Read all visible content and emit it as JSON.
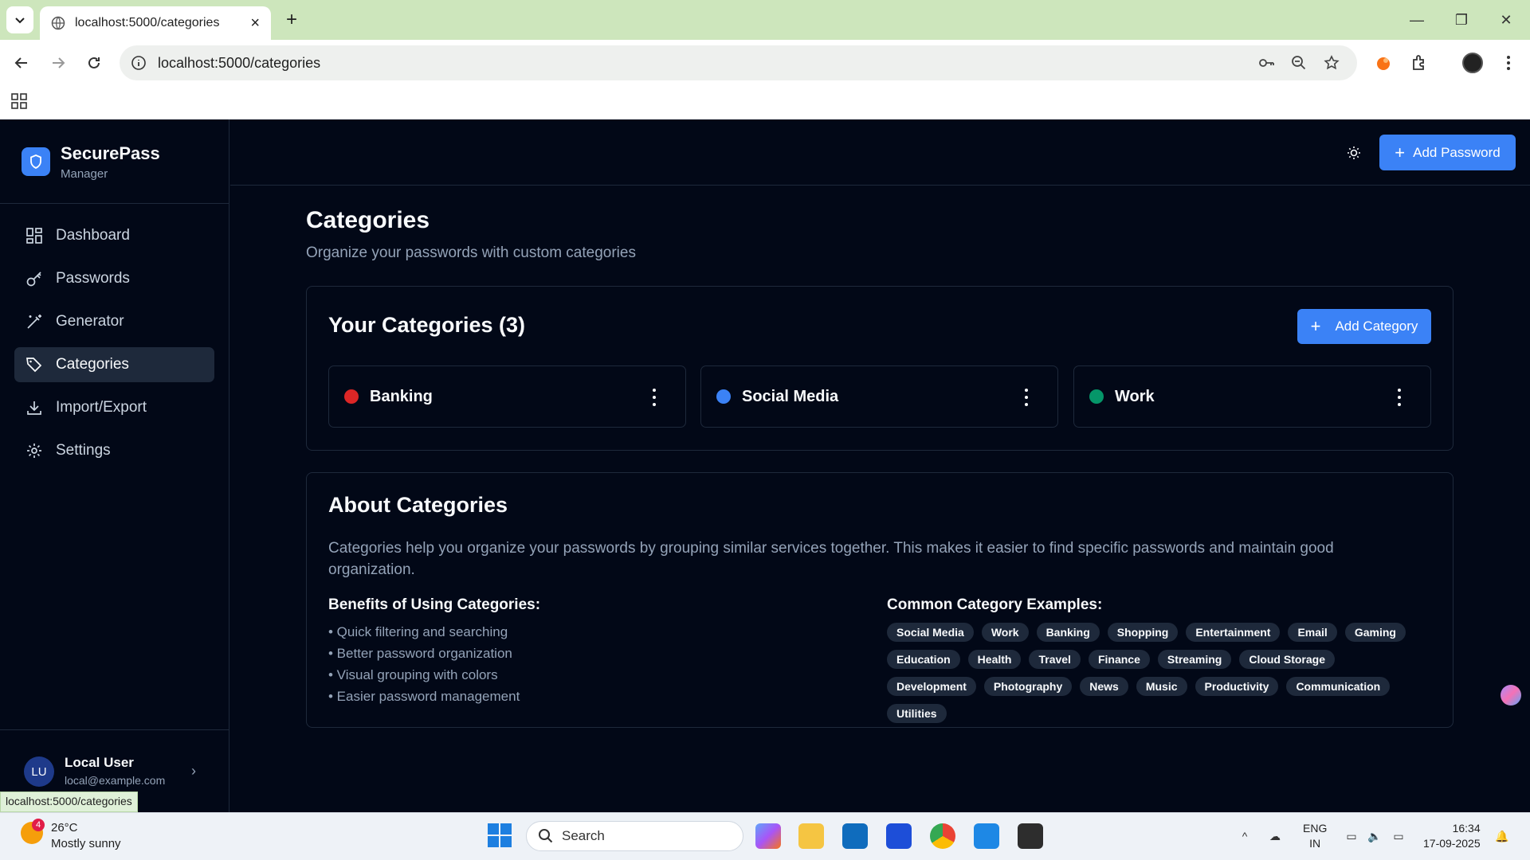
{
  "browser": {
    "tab_title": "localhost:5000/categories",
    "url": "localhost:5000/categories",
    "status_url": "localhost:5000/categories"
  },
  "brand": {
    "name": "SecurePass",
    "subtitle": "Manager"
  },
  "sidebar": {
    "items": [
      {
        "label": "Dashboard",
        "icon": "dashboard-icon",
        "active": false
      },
      {
        "label": "Passwords",
        "icon": "key-icon",
        "active": false
      },
      {
        "label": "Generator",
        "icon": "wand-icon",
        "active": false
      },
      {
        "label": "Categories",
        "icon": "tag-icon",
        "active": true
      },
      {
        "label": "Import/Export",
        "icon": "download-icon",
        "active": false
      },
      {
        "label": "Settings",
        "icon": "gear-icon",
        "active": false
      }
    ]
  },
  "user": {
    "initials": "LU",
    "name": "Local User",
    "email": "local@example.com"
  },
  "topbar": {
    "add_password_label": "Add Password"
  },
  "page": {
    "title": "Categories",
    "subtitle": "Organize your passwords with custom categories"
  },
  "categories_card": {
    "title": "Your Categories (3)",
    "add_label": "Add Category",
    "items": [
      {
        "name": "Banking",
        "color": "#dc2626"
      },
      {
        "name": "Social Media",
        "color": "#3b82f6"
      },
      {
        "name": "Work",
        "color": "#059669"
      }
    ]
  },
  "about": {
    "title": "About Categories",
    "description": "Categories help you organize your passwords by grouping similar services together. This makes it easier to find specific passwords and maintain good organization.",
    "benefits_title": "Benefits of Using Categories:",
    "benefits": [
      "• Quick filtering and searching",
      "• Better password organization",
      "• Visual grouping with colors",
      "• Easier password management"
    ],
    "examples_title": "Common Category Examples:",
    "examples": [
      "Social Media",
      "Work",
      "Banking",
      "Shopping",
      "Entertainment",
      "Email",
      "Gaming",
      "Education",
      "Health",
      "Travel",
      "Finance",
      "Streaming",
      "Cloud Storage",
      "Development",
      "Photography",
      "News",
      "Music",
      "Productivity",
      "Communication",
      "Utilities"
    ]
  },
  "taskbar": {
    "weather_temp": "26°C",
    "weather_desc": "Mostly sunny",
    "weather_badge": "4",
    "search_label": "Search",
    "lang_line1": "ENG",
    "lang_line2": "IN",
    "time": "16:34",
    "date": "17-09-2025"
  },
  "colors": {
    "accent": "#3b82f6",
    "background": "#020817",
    "border": "#1e293b"
  }
}
